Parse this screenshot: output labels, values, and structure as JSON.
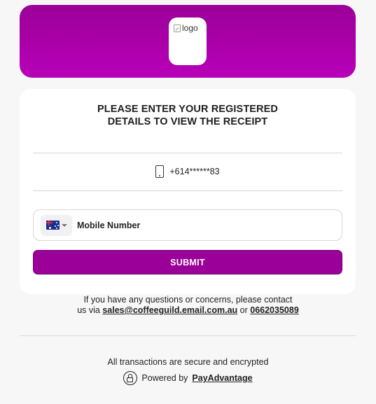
{
  "header": {
    "logo_alt": "logo"
  },
  "form": {
    "title_line1": "PLEASE ENTER YOUR REGISTERED",
    "title_line2": "DETAILS TO VIEW THE RECEIPT",
    "masked_phone": "+614******83",
    "country_icon": "australia-flag-icon",
    "mobile_placeholder": "Mobile Number",
    "mobile_value": "",
    "submit_label": "SUBMIT"
  },
  "contact": {
    "line1": "If you have any questions or concerns, please contact",
    "prefix": "us via",
    "email": "sales@coffeeguild.email.com.au",
    "or": "or",
    "phone": "0662035089"
  },
  "footer": {
    "secure_text": "All transactions are secure and encrypted",
    "powered_by": "Powered by",
    "brand": "PayAdvantage"
  },
  "colors": {
    "brand": "#9b0098",
    "brand_gradient_end": "#b800b8",
    "background": "#f7f7f8"
  }
}
